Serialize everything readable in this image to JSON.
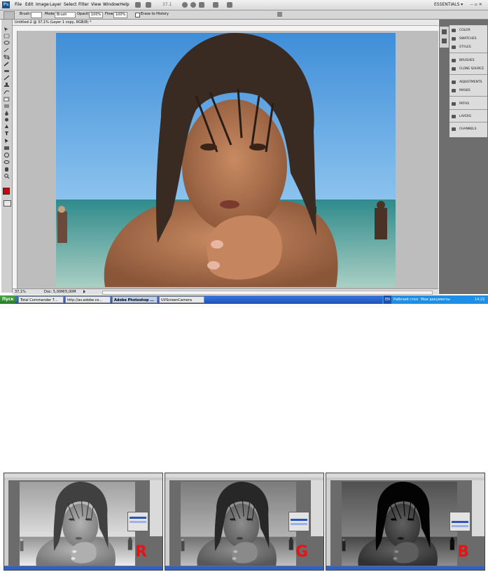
{
  "menubar": {
    "logo": "Ps",
    "items": [
      "File",
      "Edit",
      "Image",
      "Layer",
      "Select",
      "Filter",
      "View",
      "Window",
      "Help"
    ],
    "zoom_value": "37.1",
    "workspace": "ESSENTIALS ▾"
  },
  "options": {
    "brush_label": "Brush:",
    "mode_label": "Mode:",
    "mode_value": "Brush",
    "opacity_label": "Opacity:",
    "opacity_value": "100%",
    "flow_label": "Flow:",
    "flow_value": "100%",
    "erase_history": "Erase to History"
  },
  "document": {
    "tab_title": "Untitled-2 @ 37,1% (Layer 1 copy, RGB/8) *",
    "zoom": "37,1%",
    "doc_size": "Doc: 5,00M/5,00M"
  },
  "panels": [
    {
      "label": "COLOR",
      "icon": "color-icon"
    },
    {
      "label": "SWATCHES",
      "icon": "swatches-icon"
    },
    {
      "label": "STYLES",
      "icon": "styles-icon"
    },
    {
      "label": "BRUSHES",
      "icon": "brushes-icon"
    },
    {
      "label": "CLONE SOURCE",
      "icon": "clone-source-icon"
    },
    {
      "label": "ADJUSTMENTS",
      "icon": "adjustments-icon"
    },
    {
      "label": "MASKS",
      "icon": "masks-icon"
    },
    {
      "label": "PATHS",
      "icon": "paths-icon"
    },
    {
      "label": "LAYERS",
      "icon": "layers-icon"
    },
    {
      "label": "CHANNELS",
      "icon": "channels-icon"
    }
  ],
  "taskbar": {
    "start": "Пуск",
    "tasks": [
      "Total Commander 7...",
      "http://av.adobe.co...",
      "Adobe Photoshop ...",
      "UVScreenCamera"
    ],
    "active_index": 2,
    "tray_desktop": "Рабочий стол",
    "tray_docs": "Мои документы",
    "tray_lang": "EN",
    "clock": "14:22"
  },
  "channel_thumbs": [
    {
      "letter": "R"
    },
    {
      "letter": "G"
    },
    {
      "letter": "B"
    }
  ],
  "colors": {
    "foreground": "#cc0000",
    "background": "#ffffff",
    "taskbar": "#245edb",
    "channel_letter": "#e61414"
  }
}
